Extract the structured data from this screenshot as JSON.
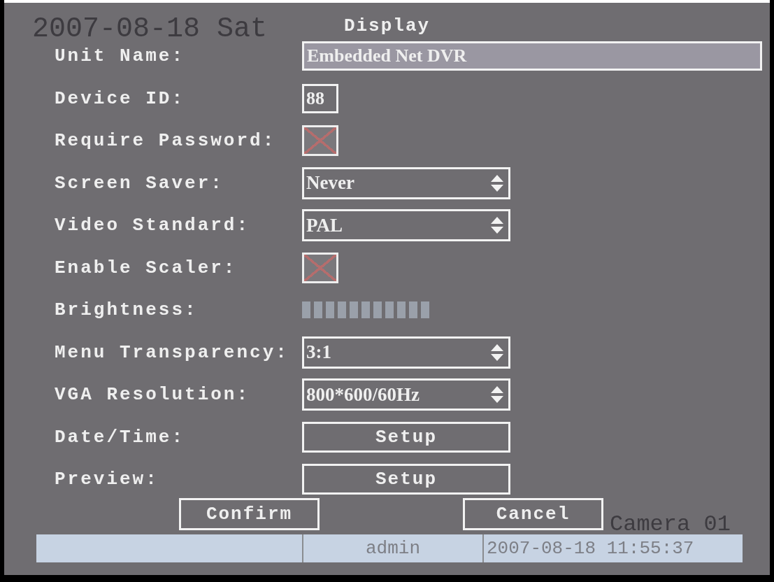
{
  "title": "Display",
  "osd_date": "2007-08-18 Sat",
  "osd_camera": "Camera 01",
  "rows": [
    {
      "kind": "text",
      "label": "Unit Name:",
      "value": "Embedded Net DVR"
    },
    {
      "kind": "number",
      "label": "Device ID:",
      "value": "88"
    },
    {
      "kind": "checkbox",
      "label": "Require Password:",
      "checked": true
    },
    {
      "kind": "select",
      "label": "Screen Saver:",
      "value": "Never"
    },
    {
      "kind": "select",
      "label": "Video Standard:",
      "value": "PAL"
    },
    {
      "kind": "checkbox",
      "label": "Enable Scaler:",
      "checked": true
    },
    {
      "kind": "meter",
      "label": "Brightness:",
      "level": 1
    },
    {
      "kind": "select",
      "label": "Menu Transparency:",
      "value": "3:1"
    },
    {
      "kind": "select",
      "label": "VGA Resolution:",
      "value": "800*600/60Hz"
    },
    {
      "kind": "button",
      "label": "Date/Time:",
      "value": "Setup"
    },
    {
      "kind": "button",
      "label": "Preview:",
      "value": "Setup"
    }
  ],
  "buttons": [
    "Confirm",
    "Cancel"
  ],
  "status_bar": {
    "user": "admin",
    "datetime": "2007-08-18 11:55:37"
  }
}
